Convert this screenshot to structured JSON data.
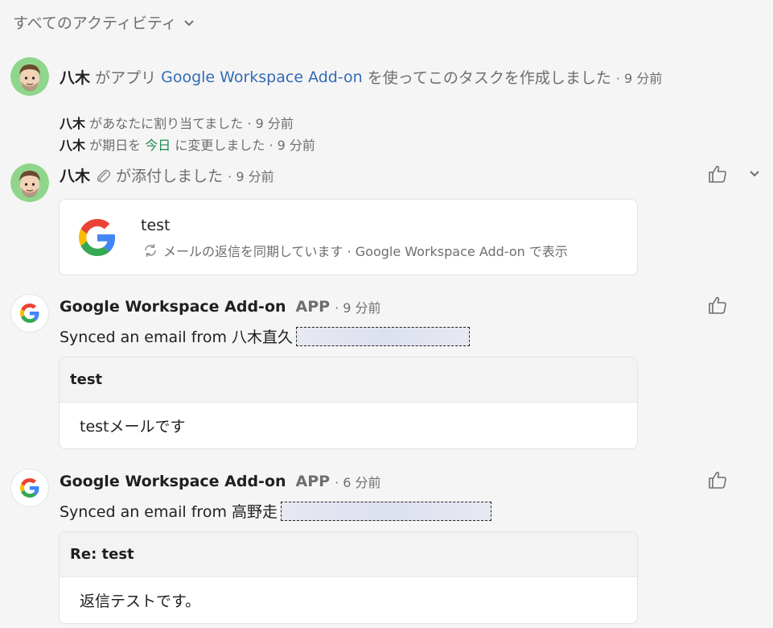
{
  "filter": {
    "label": "すべてのアクティビティ"
  },
  "entries": {
    "created": {
      "user": "八木",
      "pre": "がアプリ",
      "app": "Google Workspace Add-on",
      "post": "を使ってこのタスクを作成しました",
      "time": "· 9 分前"
    },
    "assigned": {
      "user": "八木",
      "text": "があなたに割り当てました",
      "time": "· 9 分前"
    },
    "due": {
      "user": "八木",
      "pre": "が期日を",
      "date": "今日",
      "post": "に変更しました",
      "time": "· 9 分前"
    },
    "attached": {
      "user": "八木",
      "text": "が添付しました",
      "time": "· 9 分前",
      "card": {
        "title": "test",
        "sub": "メールの返信を同期しています · Google Workspace Add-on で表示"
      }
    },
    "synced1": {
      "app": "Google Workspace Add-on",
      "tag": "APP",
      "time": "· 9 分前",
      "synced": "Synced an email from 八木直久",
      "email": {
        "subject": "test",
        "body": "testメールです"
      }
    },
    "synced2": {
      "app": "Google Workspace Add-on",
      "tag": "APP",
      "time": "· 6 分前",
      "synced": "Synced an email from 高野走",
      "email": {
        "subject": "Re: test",
        "body": "返信テストです。"
      }
    }
  },
  "colors": {
    "link": "#2f6cb5",
    "date": "#1f8a52",
    "background": "#f6f5f5"
  }
}
